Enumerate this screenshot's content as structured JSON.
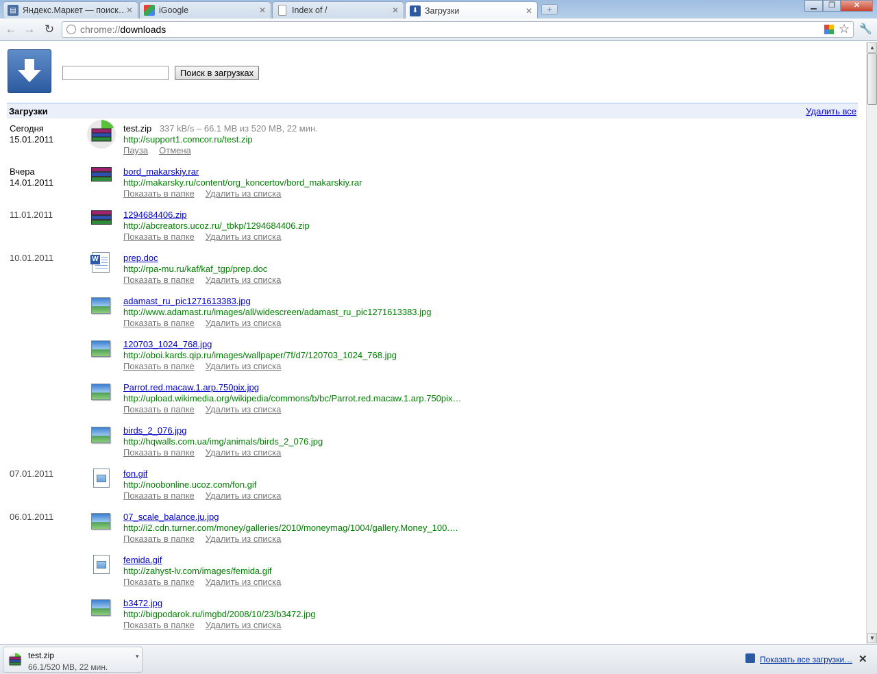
{
  "tabs": [
    {
      "title": "Яндекс.Маркет — поиск…",
      "icon": "yandex-market-favicon",
      "color": "#4a6fa5"
    },
    {
      "title": "iGoogle",
      "icon": "igoogle-favicon",
      "color": "#3a9b3a"
    },
    {
      "title": "Index of /",
      "icon": "page-favicon",
      "color": "#ffffff"
    },
    {
      "title": "Загрузки",
      "icon": "downloads-favicon",
      "color": "#2c5aa0"
    }
  ],
  "toolbar": {
    "url_scheme": "chrome://",
    "url_rest": "downloads"
  },
  "search": {
    "value": "",
    "button_label": "Поиск в загрузках"
  },
  "header": {
    "title": "Загрузки",
    "clear_all": "Удалить все"
  },
  "dates": [
    {
      "label": "Сегодня",
      "date": "15.01.2011"
    },
    {
      "label": "Вчера",
      "date": "14.01.2011"
    },
    {
      "label": "",
      "date": "11.01.2011"
    },
    {
      "label": "",
      "date": "10.01.2011"
    },
    {
      "label": "",
      "date": "07.01.2011"
    },
    {
      "label": "",
      "date": "06.01.2011"
    }
  ],
  "downloads": [
    {
      "file": "test.zip",
      "progress": "337 kB/s – 66.1 MB из 520 MB, 22 мин.",
      "url": "http://support1.comcor.ru/test.zip",
      "action1": "Пауза",
      "action2": "Отмена",
      "icon": "rar-archive-icon"
    },
    {
      "file": "bord_makarskiy.rar",
      "url": "http://makarsky.ru/content/org_koncertov/bord_makarskiy.rar",
      "action1": "Показать в папке",
      "action2": "Удалить из списка",
      "icon": "rar-archive-icon"
    },
    {
      "file": "1294684406.zip",
      "url": "http://abcreators.ucoz.ru/_tbkp/1294684406.zip",
      "action1": "Показать в папке",
      "action2": "Удалить из списка",
      "icon": "rar-archive-icon"
    },
    {
      "file": "prep.doc",
      "url": "http://rpa-mu.ru/kaf/kaf_tgp/prep.doc",
      "action1": "Показать в папке",
      "action2": "Удалить из списка",
      "icon": "word-document-icon"
    },
    {
      "file": "adamast_ru_pic1271613383.jpg",
      "url": "http://www.adamast.ru/images/all/widescreen/adamast_ru_pic1271613383.jpg",
      "action1": "Показать в папке",
      "action2": "Удалить из списка",
      "icon": "image-file-icon"
    },
    {
      "file": "120703_1024_768.jpg",
      "url": "http://oboi.kards.qip.ru/images/wallpaper/7f/d7/120703_1024_768.jpg",
      "action1": "Показать в папке",
      "action2": "Удалить из списка",
      "icon": "image-file-icon"
    },
    {
      "file": "Parrot.red.macaw.1.arp.750pix.jpg",
      "url": "http://upload.wikimedia.org/wikipedia/commons/b/bc/Parrot.red.macaw.1.arp.750pix…",
      "action1": "Показать в папке",
      "action2": "Удалить из списка",
      "icon": "image-file-icon"
    },
    {
      "file": "birds_2_076.jpg",
      "url": "http://hqwalls.com.ua/img/animals/birds_2_076.jpg",
      "action1": "Показать в папке",
      "action2": "Удалить из списка",
      "icon": "image-file-icon"
    },
    {
      "file": "fon.gif",
      "url": "http://noobonline.ucoz.com/fon.gif",
      "action1": "Показать в папке",
      "action2": "Удалить из списка",
      "icon": "gif-file-icon"
    },
    {
      "file": "07_scale_balance.ju.jpg",
      "url": "http://i2.cdn.turner.com/money/galleries/2010/moneymag/1004/gallery.Money_100.…",
      "action1": "Показать в папке",
      "action2": "Удалить из списка",
      "icon": "image-file-icon"
    },
    {
      "file": "femida.gif",
      "url": "http://zahyst-lv.com/images/femida.gif",
      "action1": "Показать в папке",
      "action2": "Удалить из списка",
      "icon": "gif-file-icon"
    },
    {
      "file": "b3472.jpg",
      "url": "http://bigpodarok.ru/imgbd/2008/10/23/b3472.jpg",
      "action1": "Показать в папке",
      "action2": "Удалить из списка",
      "icon": "image-file-icon"
    }
  ],
  "shelf": {
    "file": "test.zip",
    "status": "66.1/520 MB, 22 мин.",
    "show_all": "Показать все загрузки…"
  }
}
